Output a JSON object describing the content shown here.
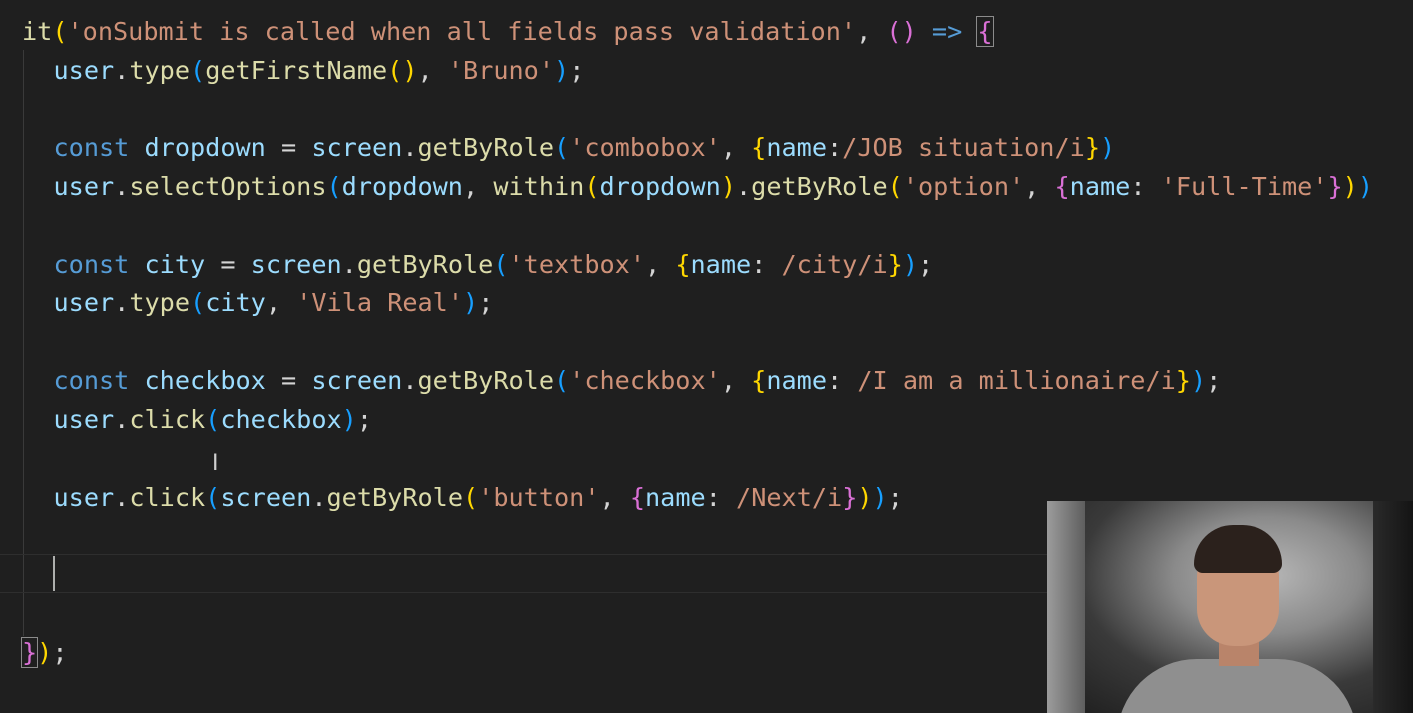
{
  "editor": {
    "language": "javascript",
    "lines": {
      "l1": {
        "it": "it",
        "open_paren": "(",
        "test_name": "'onSubmit is called when all fields pass validation'",
        "comma": ", ",
        "arrow_parens": "()",
        "arrow": " => ",
        "open_brace": "{"
      },
      "l2": {
        "obj": "user",
        "dot": ".",
        "method": "type",
        "open": "(",
        "arg_fn": "getFirstName",
        "arg_parens": "()",
        "comma": ", ",
        "value": "'Bruno'",
        "close": ")",
        "semi": ";"
      },
      "l4": {
        "keyword": "const",
        "name": "dropdown",
        "eq": " = ",
        "obj": "screen",
        "dot": ".",
        "method": "getByRole",
        "open": "(",
        "role": "'combobox'",
        "comma": ", ",
        "obrace": "{",
        "key": "name",
        "colon": ":",
        "regex": "/JOB situation/i",
        "cbrace": "}",
        "close": ")"
      },
      "l5": {
        "obj": "user",
        "dot": ".",
        "method": "selectOptions",
        "open": "(",
        "arg": "dropdown",
        "comma": ", ",
        "within": "within",
        "wopen": "(",
        "warg": "dropdown",
        "wclose": ")",
        "dot2": ".",
        "method2": "getByRole",
        "open2": "(",
        "role": "'option'",
        "comma2": ", ",
        "obrace": "{",
        "key": "name",
        "colon": ": ",
        "value": "'Full-Time'",
        "cbrace": "}",
        "close2": ")",
        "close": ")"
      },
      "l7": {
        "keyword": "const",
        "name": "city",
        "eq": " = ",
        "obj": "screen",
        "dot": ".",
        "method": "getByRole",
        "open": "(",
        "role": "'textbox'",
        "comma": ", ",
        "obrace": "{",
        "key": "name",
        "colon": ": ",
        "regex": "/city/i",
        "cbrace": "}",
        "close": ")",
        "semi": ";"
      },
      "l8": {
        "obj": "user",
        "dot": ".",
        "method": "type",
        "open": "(",
        "arg": "city",
        "comma": ", ",
        "value": "'Vila Real'",
        "close": ")",
        "semi": ";"
      },
      "l10": {
        "keyword": "const",
        "name": "checkbox",
        "eq": " = ",
        "obj": "screen",
        "dot": ".",
        "method": "getByRole",
        "open": "(",
        "role": "'checkbox'",
        "comma": ", ",
        "obrace": "{",
        "key": "name",
        "colon": ": ",
        "regex": "/I am a millionaire/i",
        "cbrace": "}",
        "close": ")",
        "semi": ";"
      },
      "l11": {
        "obj": "user",
        "dot": ".",
        "method": "click",
        "open": "(",
        "arg": "checkbox",
        "close": ")",
        "semi": ";"
      },
      "l13": {
        "obj": "user",
        "dot": ".",
        "method": "click",
        "open": "(",
        "obj2": "screen",
        "dot2": ".",
        "method2": "getByRole",
        "open2": "(",
        "role": "'button'",
        "comma": ", ",
        "obrace": "{",
        "key": "name",
        "colon": ": ",
        "regex": "/Next/i",
        "cbrace": "}",
        "close2": ")",
        "close": ")",
        "semi": ";"
      },
      "l16": {
        "cbrace": "}",
        "close": ")",
        "semi": ";"
      }
    }
  },
  "colors": {
    "background": "#1f1f1f",
    "keyword": "#569cd6",
    "string": "#ce9178",
    "function": "#dcdcaa",
    "variable": "#9cdcfe",
    "bracket_gold": "#ffd700",
    "bracket_orchid": "#da70d6",
    "bracket_blue": "#179fff"
  },
  "icons": {
    "cursor": "text-ibeam-cursor-icon"
  }
}
